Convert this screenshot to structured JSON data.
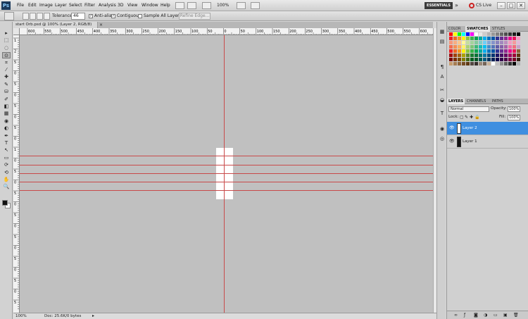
{
  "menubar": {
    "app_logo": "Ps",
    "items": [
      "File",
      "Edit",
      "Image",
      "Layer",
      "Select",
      "Filter",
      "Analysis",
      "3D",
      "View",
      "Window",
      "Help"
    ],
    "zoom": "100%",
    "workspace": "ESSENTIALS",
    "overflow": "»",
    "cs_live": "CS Live",
    "window_buttons": [
      "–",
      "□",
      "✕"
    ]
  },
  "options": {
    "tolerance_label": "Tolerance:",
    "tolerance_value": "46",
    "antialias_label": "Anti-alias",
    "contiguous_label": "Contiguous",
    "sample_all_label": "Sample All Layers",
    "refine_label": "Refine Edge..."
  },
  "document": {
    "tab_title": "start Orb.psd @ 100% (Layer 2, RGB/8)",
    "close": "×",
    "status_zoom": "100%",
    "status_doc": "Doc: 25.6K/0 bytes"
  },
  "ruler": {
    "h_ticks": [
      "600",
      "550",
      "500",
      "450",
      "400",
      "350",
      "300",
      "250",
      "200",
      "150",
      "100",
      "50",
      "0",
      "50",
      "100",
      "150",
      "200",
      "250",
      "300",
      "350",
      "400",
      "450",
      "500",
      "550",
      "600",
      "650"
    ],
    "v_ticks": [
      "1",
      "2",
      "5",
      "0",
      "5",
      "0",
      "5",
      "0",
      "5",
      "0",
      "1",
      "0",
      "5",
      "0",
      "5",
      "0",
      "5",
      "0",
      "5",
      "0",
      "5",
      "0",
      "5",
      "0",
      "5"
    ]
  },
  "toolbar": {
    "tools": [
      "move-tool",
      "marquee-tool",
      "lasso-tool",
      "quick-select-tool",
      "crop-tool",
      "eyedropper-tool",
      "healing-tool",
      "brush-tool",
      "clone-tool",
      "history-brush-tool",
      "eraser-tool",
      "gradient-tool",
      "blur-tool",
      "dodge-tool",
      "pen-tool",
      "type-tool",
      "path-select-tool",
      "shape-tool",
      "3d-rotate-tool",
      "3d-orbit-tool",
      "hand-tool",
      "zoom-tool"
    ],
    "glyphs": [
      "▸",
      "⬚",
      "◌",
      "⊙",
      "⌗",
      "⁄",
      "✚",
      "✎",
      "⛁",
      "✐",
      "◧",
      "▦",
      "◉",
      "◐",
      "✒",
      "T",
      "↖",
      "▭",
      "⟳",
      "⟲",
      "✋",
      "🔍"
    ]
  },
  "panels": {
    "color_tabs": [
      "COLOR",
      "SWATCHES",
      "STYLES"
    ],
    "layers_tabs": [
      "LAYERS",
      "CHANNELS",
      "PATHS"
    ],
    "blend_mode": "Normal",
    "opacity_label": "Opacity:",
    "opacity_value": "100%",
    "lock_label": "Lock:",
    "fill_label": "Fill:",
    "fill_value": "100%",
    "layers": [
      {
        "name": "Layer 2",
        "selected": true
      },
      {
        "name": "Layer 1",
        "selected": false
      }
    ],
    "swatch_colors": [
      [
        "#ff0000",
        "#ffff00",
        "#00ff00",
        "#00ffff",
        "#0000ff",
        "#ff00ff",
        "#ffffff",
        "#e6e6e6",
        "#cccccc",
        "#b3b3b3",
        "#999999",
        "#808080",
        "#666666",
        "#4d4d4d",
        "#333333",
        "#1a1a1a",
        "#000000"
      ],
      [
        "#ed1c24",
        "#f26522",
        "#f7941d",
        "#fff200",
        "#8dc63f",
        "#39b54a",
        "#00a651",
        "#00a99d",
        "#00aeef",
        "#0072bc",
        "#0054a6",
        "#2e3192",
        "#662d91",
        "#92278f",
        "#ec008c",
        "#ed145b",
        "#f49ac1"
      ],
      [
        "#f7977a",
        "#f9ad81",
        "#fdc68a",
        "#fff79a",
        "#c4df9b",
        "#a3d39c",
        "#82ca9d",
        "#7bcdc8",
        "#6ecff6",
        "#7ea7d8",
        "#8493ca",
        "#8882be",
        "#a187be",
        "#bc8dbf",
        "#f49ac2",
        "#f6989d",
        "#e1b8d9"
      ],
      [
        "#f26c4f",
        "#f68e55",
        "#fbaf5c",
        "#fff467",
        "#acd372",
        "#7cc576",
        "#3bb878",
        "#1abbb4",
        "#00bff3",
        "#438cca",
        "#5574b9",
        "#605ca8",
        "#855fa8",
        "#a763a8",
        "#f06ea9",
        "#f26d7d",
        "#c6a1c9"
      ],
      [
        "#ed1c24",
        "#f26522",
        "#f7941d",
        "#fff200",
        "#8dc63f",
        "#39b54a",
        "#00a651",
        "#00a99d",
        "#00aeef",
        "#0072bc",
        "#0054a6",
        "#2e3192",
        "#662d91",
        "#92278f",
        "#ec008c",
        "#ed145b",
        "#8c6239"
      ],
      [
        "#9e0b0f",
        "#a0410d",
        "#a3620a",
        "#aba000",
        "#598527",
        "#1a7b30",
        "#007236",
        "#00746b",
        "#0076a3",
        "#004b80",
        "#003471",
        "#1b1464",
        "#440e62",
        "#630460",
        "#9e005d",
        "#9e0039",
        "#603913"
      ],
      [
        "#790000",
        "#7b2e00",
        "#7d4900",
        "#827b00",
        "#406618",
        "#005e20",
        "#005826",
        "#005952",
        "#005b7f",
        "#003663",
        "#002157",
        "#0d004c",
        "#32004b",
        "#4b0049",
        "#7b0046",
        "#7a0026",
        "#3c2415"
      ],
      [
        "#c69c6d",
        "#a67c52",
        "#8c6239",
        "#754c24",
        "#603913",
        "#534741",
        "#362f2d",
        "#998675",
        "#736357",
        "#c7b299",
        "#ffffff",
        "#c0c0c0",
        "#909090",
        "#606060",
        "#303030",
        "#000000",
        "#b0b0b0"
      ]
    ]
  },
  "colors": {
    "guide": "#c94a4a",
    "selection": "#3f8fe0"
  }
}
